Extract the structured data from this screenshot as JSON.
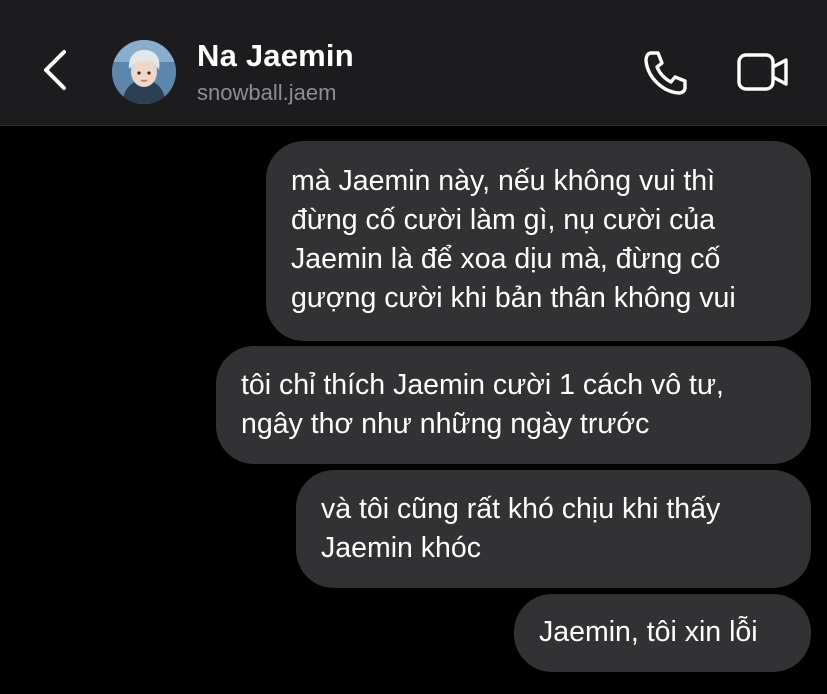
{
  "header": {
    "name": "Na Jaemin",
    "handle": "snowball.jaem"
  },
  "icons": {
    "back": "chevron-left-icon",
    "avatar": "profile-photo",
    "call": "phone-icon",
    "video": "video-camera-icon"
  },
  "colors": {
    "background": "#000000",
    "header": "#1c1c1e",
    "bubble": "#323234",
    "text": "#ffffff",
    "secondary_text": "#8e8e93"
  },
  "messages": [
    {
      "text": "mà Jaemin này, nếu không vui thì\nđừng cố cười làm gì, nụ cười của\nJaemin là để xoa dịu mà, đừng cố\ngượng cười khi bản thân không vui"
    },
    {
      "text": "tôi chỉ thích Jaemin cười 1 cách vô tư,\nngây thơ như những ngày trước"
    },
    {
      "text": "và tôi cũng rất khó chịu khi thấy\nJaemin khóc"
    },
    {
      "text": "Jaemin, tôi xin lỗi"
    }
  ]
}
